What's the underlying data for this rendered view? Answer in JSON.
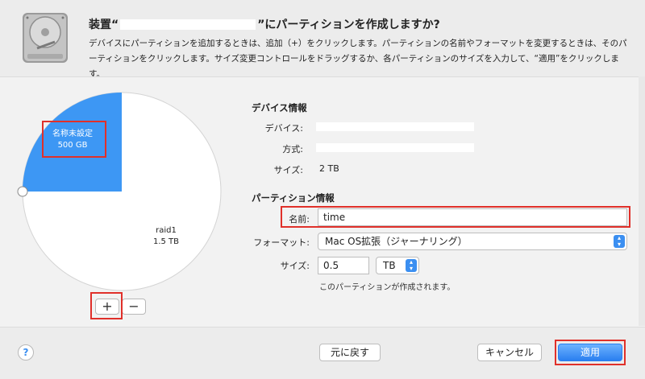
{
  "header": {
    "title_prefix": "装置“",
    "title_suffix": "”にパーティションを作成しますか?",
    "description": "デバイスにパーティションを追加するときは、追加（+）をクリックします。パーティションの名前やフォーマットを変更するときは、そのパーティションをクリックします。サイズ変更コントロールをドラッグするか、各パーティションのサイズを入力して、“適用”をクリックします。"
  },
  "pie": {
    "partitions": [
      {
        "name": "名称未設定",
        "size": "500 GB",
        "fraction": 0.25,
        "color": "#3d97f4"
      },
      {
        "name": "raid1",
        "size": "1.5 TB",
        "fraction": 0.75,
        "color": "#ffffff"
      }
    ],
    "add_label": "+",
    "remove_label": "−"
  },
  "device_info": {
    "heading": "デバイス情報",
    "device_label": "デバイス:",
    "scheme_label": "方式:",
    "size_label": "サイズ:",
    "size_value": "2 TB"
  },
  "partition_info": {
    "heading": "パーティション情報",
    "name_label": "名前:",
    "name_value": "time",
    "format_label": "フォーマット:",
    "format_value": "Mac OS拡張（ジャーナリング）",
    "size_label": "サイズ:",
    "size_value": "0.5",
    "unit_value": "TB",
    "note": "このパーティションが作成されます。"
  },
  "footer": {
    "help_label": "?",
    "revert_label": "元に戻す",
    "cancel_label": "キャンセル",
    "apply_label": "適用"
  },
  "colors": {
    "accent": "#3d97f4",
    "highlight": "#e0302a"
  }
}
